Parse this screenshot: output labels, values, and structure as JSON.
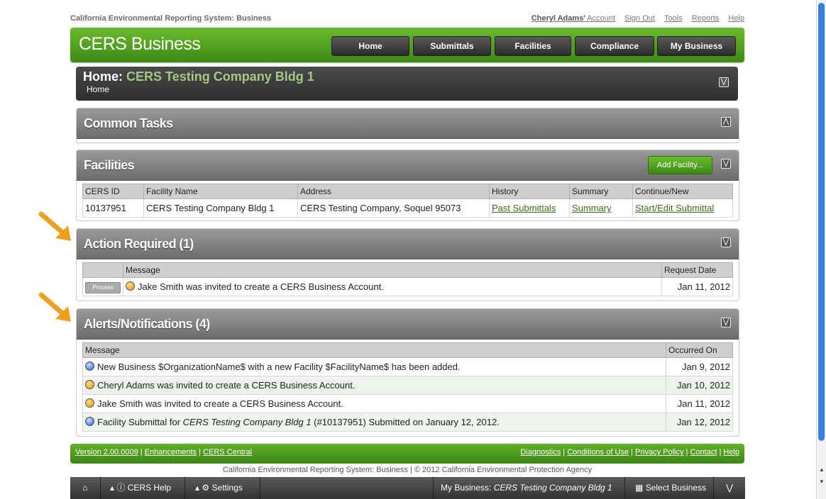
{
  "top": {
    "app_title": "California Environmental Reporting System: Business",
    "account_name": "Cheryl Adams'",
    "account_label": "Account",
    "links": [
      "Sign Out",
      "Tools",
      "Reports",
      "Help"
    ]
  },
  "header": {
    "brand": "CERS Business",
    "nav": [
      "Home",
      "Submittals",
      "Facilities",
      "Compliance",
      "My Business"
    ]
  },
  "home_panel": {
    "title_prefix": "Home:",
    "company": "CERS Testing Company Bldg 1",
    "breadcrumb": "Home"
  },
  "common_tasks": {
    "title": "Common Tasks"
  },
  "facilities": {
    "title": "Facilities",
    "add_button": "Add Facility...",
    "columns": [
      "CERS ID",
      "Facility Name",
      "Address",
      "History",
      "Summary",
      "Continue/New"
    ],
    "rows": [
      {
        "id": "10137951",
        "name": "CERS Testing Company Bldg 1",
        "address": "CERS Testing Company, Soquel 95073",
        "history": "Past Submittals",
        "summary": "Summary",
        "continue": "Start/Edit Submittal"
      }
    ]
  },
  "action_required": {
    "title": "Action Required (1)",
    "columns": [
      "",
      "Message",
      "Request Date"
    ],
    "rows": [
      {
        "button": "Process",
        "message": "Jake Smith was invited to create a CERS Business Account.",
        "date": "Jan 11, 2012"
      }
    ]
  },
  "alerts": {
    "title": "Alerts/Notifications (4)",
    "columns": [
      "Message",
      "Occurred On"
    ],
    "rows": [
      {
        "icon": "blue",
        "message": "New Business $OrganizationName$ with a new Facility $FacilityName$ has been added.",
        "date": "Jan 9, 2012"
      },
      {
        "icon": "orange",
        "message": "Cheryl Adams was invited to create a CERS Business Account.",
        "date": "Jan 10, 2012"
      },
      {
        "icon": "orange",
        "message": "Jake Smith was invited to create a CERS Business Account.",
        "date": "Jan 11, 2012"
      },
      {
        "icon": "blue",
        "message_pre": "Facility Submittal for ",
        "message_em": "CERS Testing Company Bldg 1",
        "message_post": " (#10137951) Submitted on January 12, 2012.",
        "date": "Jan 12, 2012"
      }
    ]
  },
  "footer": {
    "left_links": [
      "Version 2.00.0009",
      "Enhancements",
      "CERS Central"
    ],
    "right_links": [
      "Diagnostics",
      "Conditions of Use",
      "Privacy Policy",
      "Contact",
      "Help"
    ],
    "separator": " | ",
    "copyright": "California Environmental Reporting System: Business | © 2012 California Environmental Protection Agency"
  },
  "toolbar": {
    "help": "CERS Help",
    "settings": "Settings",
    "my_business_label": "My Business:",
    "my_business_value": "CERS Testing Company Bldg 1",
    "select": "Select Business"
  },
  "colors": {
    "header_green": "#4f9f20",
    "panel_gray": "#7d7d7d",
    "arrow_orange": "#f0a020",
    "link_green": "#3a6e1a"
  }
}
